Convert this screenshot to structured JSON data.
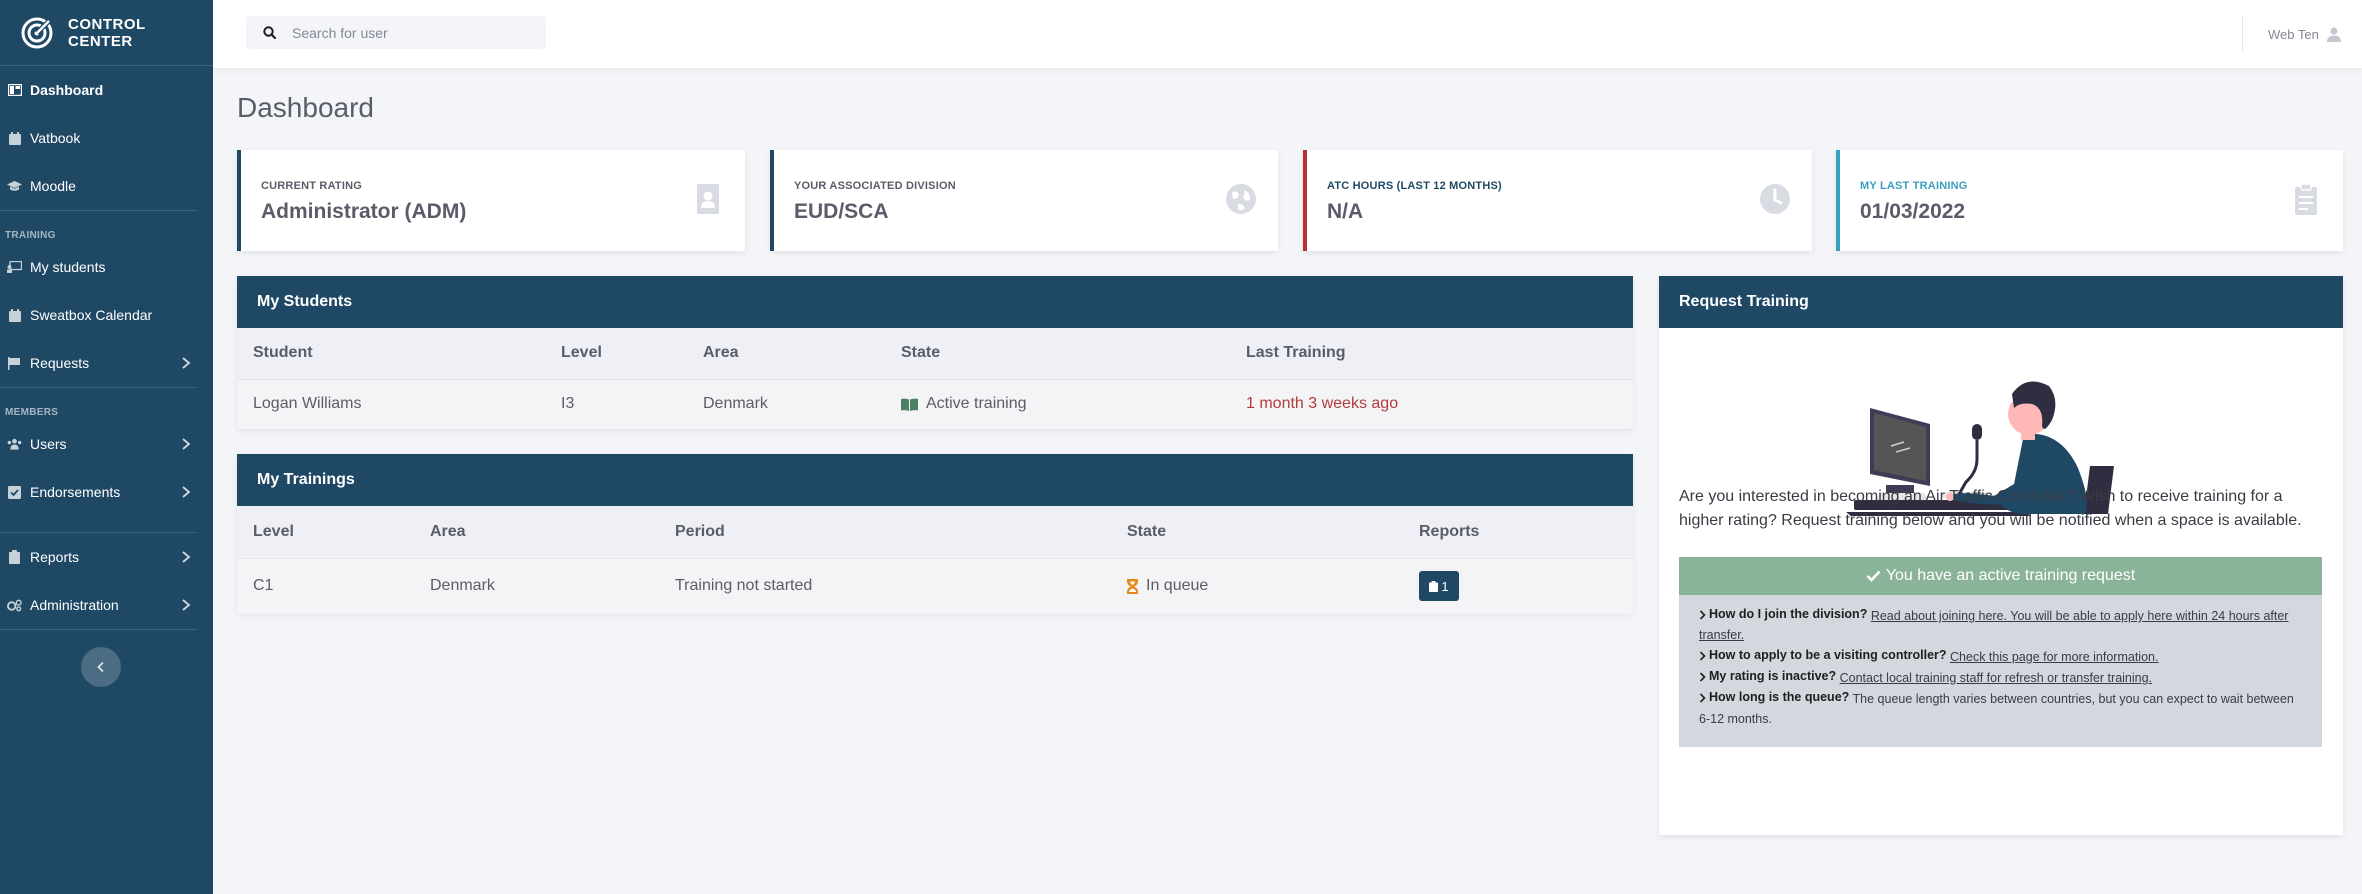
{
  "brand": {
    "line1": "CONTROL",
    "line2": "CENTER"
  },
  "sidebar": {
    "items_top": [
      {
        "label": "Dashboard",
        "icon": "dashboard-icon",
        "active": true
      },
      {
        "label": "Vatbook",
        "icon": "calendar-icon"
      },
      {
        "label": "Moodle",
        "icon": "graduation-cap-icon"
      }
    ],
    "heading_training": "TRAINING",
    "items_training": [
      {
        "label": "My students",
        "icon": "chalkboard-icon"
      },
      {
        "label": "Sweatbox Calendar",
        "icon": "calendar-icon"
      },
      {
        "label": "Requests",
        "icon": "flag-icon"
      }
    ],
    "heading_members": "MEMBERS",
    "items_members": [
      {
        "label": "Users",
        "icon": "users-icon"
      },
      {
        "label": "Endorsements",
        "icon": "check-square-icon"
      }
    ],
    "items_bottom": [
      {
        "label": "Reports",
        "icon": "clipboard-icon"
      },
      {
        "label": "Administration",
        "icon": "cogs-icon"
      }
    ]
  },
  "search": {
    "placeholder": "Search for user"
  },
  "user": {
    "name": "Web Ten"
  },
  "page": {
    "title": "Dashboard"
  },
  "stats": [
    {
      "label": "CURRENT RATING",
      "value": "Administrator (ADM)",
      "color": "#1e4864",
      "icon": "id-badge-icon"
    },
    {
      "label": "YOUR ASSOCIATED DIVISION",
      "value": "EUD/SCA",
      "color": "#1e4864",
      "icon": "globe-icon"
    },
    {
      "label": "ATC HOURS (LAST 12 MONTHS)",
      "value": "N/A",
      "color": "#b83232",
      "icon": "clock-icon"
    },
    {
      "label": "MY LAST TRAINING",
      "value": "01/03/2022",
      "color": "#3a9fbf",
      "icon": "clipboard-icon"
    }
  ],
  "students": {
    "title": "My Students",
    "columns": [
      "Student",
      "Level",
      "Area",
      "State",
      "Last Training"
    ],
    "rows": [
      {
        "student": "Logan Williams",
        "level": "I3",
        "area": "Denmark",
        "state": "Active training",
        "last": "1 month 3 weeks ago"
      }
    ]
  },
  "trainings": {
    "title": "My Trainings",
    "columns": [
      "Level",
      "Area",
      "Period",
      "State",
      "Reports"
    ],
    "rows": [
      {
        "level": "C1",
        "area": "Denmark",
        "period": "Training not started",
        "state": "In queue",
        "reports": "1"
      }
    ]
  },
  "request": {
    "title": "Request Training",
    "text": "Are you interested in becoming an Air Traffic Controller? Wish to receive training for a higher rating? Request training below and you will be notified when a space is available.",
    "banner": "You have an active training request",
    "faq": [
      {
        "q": "How do I join the division?",
        "a": "Read about joining here. You will be able to apply here within 24 hours after transfer.",
        "link": true
      },
      {
        "q": "How to apply to be a visiting controller?",
        "a": "Check this page for more information.",
        "link": true
      },
      {
        "q": "My rating is inactive?",
        "a": "Contact local training staff for refresh or transfer training.",
        "link": true
      },
      {
        "q": "How long is the queue?",
        "a": "The queue length varies between countries, but you can expect to wait between 6-12 months.",
        "link": false
      }
    ]
  },
  "colors": {
    "primary": "#1e4864",
    "success": "#8bb39a",
    "danger": "#b23b3b",
    "warning": "#e58a17"
  }
}
